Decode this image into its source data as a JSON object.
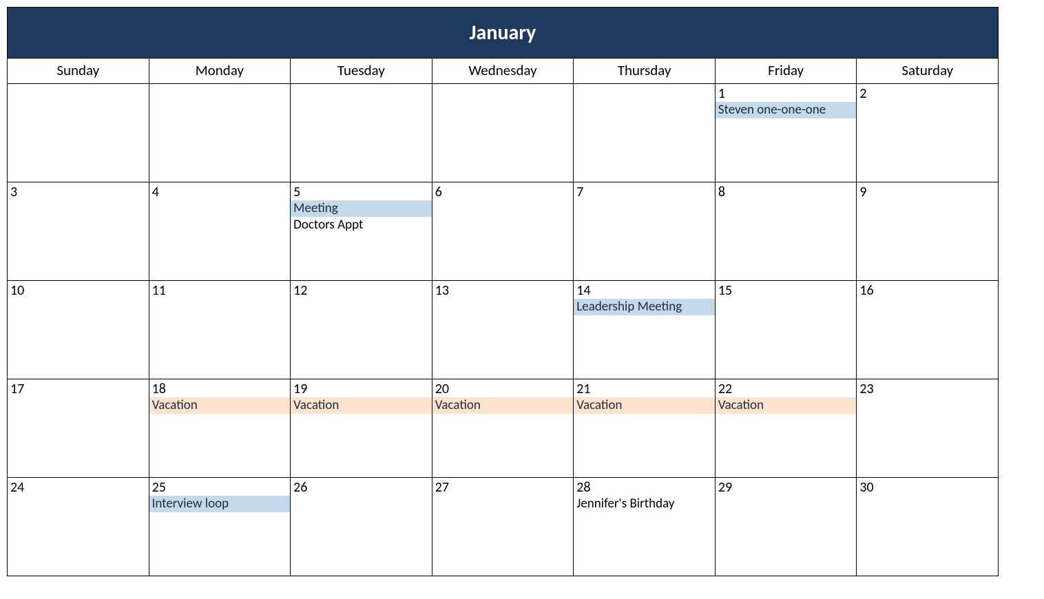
{
  "calendar": {
    "month_title": "January",
    "weekdays": [
      "Sunday",
      "Monday",
      "Tuesday",
      "Wednesday",
      "Thursday",
      "Friday",
      "Saturday"
    ],
    "weeks": [
      [
        {
          "day": "",
          "events": []
        },
        {
          "day": "",
          "events": []
        },
        {
          "day": "",
          "events": []
        },
        {
          "day": "",
          "events": []
        },
        {
          "day": "",
          "events": []
        },
        {
          "day": "1",
          "events": [
            {
              "label": "Steven one-one-one",
              "color": "blue"
            }
          ]
        },
        {
          "day": "2",
          "events": []
        }
      ],
      [
        {
          "day": "3",
          "events": []
        },
        {
          "day": "4",
          "events": []
        },
        {
          "day": "5",
          "events": [
            {
              "label": "Meeting",
              "color": "blue"
            },
            {
              "label": "Doctors Appt",
              "color": "plain"
            }
          ]
        },
        {
          "day": "6",
          "events": []
        },
        {
          "day": "7",
          "events": []
        },
        {
          "day": "8",
          "events": []
        },
        {
          "day": "9",
          "events": []
        }
      ],
      [
        {
          "day": "10",
          "events": []
        },
        {
          "day": "11",
          "events": []
        },
        {
          "day": "12",
          "events": []
        },
        {
          "day": "13",
          "events": []
        },
        {
          "day": "14",
          "events": [
            {
              "label": "Leadership Meeting",
              "color": "blue"
            }
          ]
        },
        {
          "day": "15",
          "events": []
        },
        {
          "day": "16",
          "events": []
        }
      ],
      [
        {
          "day": "17",
          "events": []
        },
        {
          "day": "18",
          "events": [
            {
              "label": "Vacation",
              "color": "orange"
            }
          ]
        },
        {
          "day": "19",
          "events": [
            {
              "label": "Vacation",
              "color": "orange"
            }
          ]
        },
        {
          "day": "20",
          "events": [
            {
              "label": "Vacation",
              "color": "orange"
            }
          ]
        },
        {
          "day": "21",
          "events": [
            {
              "label": "Vacation",
              "color": "orange"
            }
          ]
        },
        {
          "day": "22",
          "events": [
            {
              "label": "Vacation",
              "color": "orange"
            }
          ]
        },
        {
          "day": "23",
          "events": []
        }
      ],
      [
        {
          "day": "24",
          "events": []
        },
        {
          "day": "25",
          "events": [
            {
              "label": "Interview loop",
              "color": "blue"
            }
          ]
        },
        {
          "day": "26",
          "events": []
        },
        {
          "day": "27",
          "events": []
        },
        {
          "day": "28",
          "events": [
            {
              "label": "Jennifer's Birthday",
              "color": "plain"
            }
          ]
        },
        {
          "day": "29",
          "events": []
        },
        {
          "day": "30",
          "events": []
        }
      ]
    ]
  }
}
